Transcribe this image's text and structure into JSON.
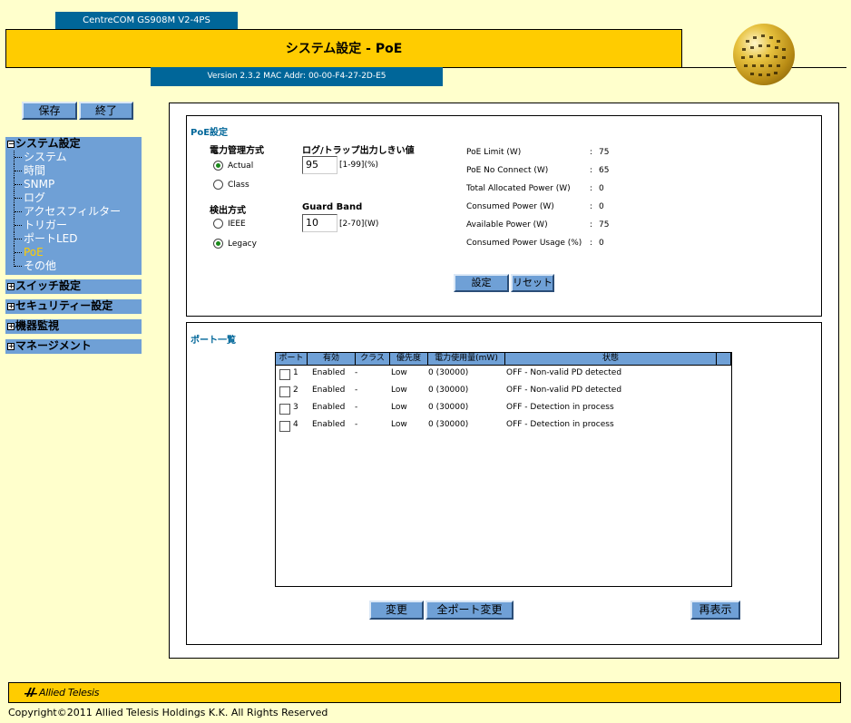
{
  "header": {
    "model": "CentreCOM GS908M V2-4PS",
    "title": "システム設定 - PoE",
    "version": "Version 2.3.2 MAC Addr: 00-00-F4-27-2D-E5"
  },
  "top_buttons": {
    "save": "保存",
    "exit": "終了"
  },
  "sidebar": {
    "system_settings": {
      "label": "システム設定",
      "items": [
        "システム",
        "時間",
        "SNMP",
        "ログ",
        "アクセスフィルター",
        "トリガー",
        "ポートLED",
        "PoE",
        "その他"
      ],
      "active": "PoE"
    },
    "switch_settings": "スイッチ設定",
    "security_settings": "セキュリティー設定",
    "device_monitor": "機器監視",
    "management": "マネージメント"
  },
  "poe": {
    "title": "PoE設定",
    "power_mgmt_label": "電力管理方式",
    "power_mgmt_options": [
      "Actual",
      "Class"
    ],
    "power_mgmt_selected": "Actual",
    "threshold_label": "ログ/トラップ出力しきい値",
    "threshold_value": "95",
    "threshold_range": "[1-99](%)",
    "detect_label": "検出方式",
    "detect_options": [
      "IEEE",
      "Legacy"
    ],
    "detect_selected": "Legacy",
    "guard_band_label": "Guard Band",
    "guard_band_value": "10",
    "guard_band_range": "[2-70](W)",
    "stats": [
      {
        "label": "PoE Limit (W)",
        "value": "75"
      },
      {
        "label": "PoE No Connect (W)",
        "value": "65"
      },
      {
        "label": "Total Allocated Power (W)",
        "value": "0"
      },
      {
        "label": "Consumed Power (W)",
        "value": "0"
      },
      {
        "label": "Available Power (W)",
        "value": "75"
      },
      {
        "label": "Consumed Power Usage (%)",
        "value": "0"
      }
    ],
    "set_button": "設定",
    "reset_button": "リセット"
  },
  "port_list": {
    "title": "ポート一覧",
    "columns": [
      "ポート",
      "有効",
      "クラス",
      "優先度",
      "電力使用量(mW)",
      "状態"
    ],
    "rows": [
      {
        "port": "1",
        "enabled": "Enabled",
        "class": "-",
        "priority": "Low",
        "power": "0 (30000)",
        "status": "OFF - Non-valid PD detected"
      },
      {
        "port": "2",
        "enabled": "Enabled",
        "class": "-",
        "priority": "Low",
        "power": "0 (30000)",
        "status": "OFF - Non-valid PD detected"
      },
      {
        "port": "3",
        "enabled": "Enabled",
        "class": "-",
        "priority": "Low",
        "power": "0 (30000)",
        "status": "OFF - Detection in process"
      },
      {
        "port": "4",
        "enabled": "Enabled",
        "class": "-",
        "priority": "Low",
        "power": "0 (30000)",
        "status": "OFF - Detection in process"
      }
    ],
    "change_button": "変更",
    "change_all_button": "全ポート変更",
    "refresh_button": "再表示"
  },
  "footer": {
    "logo": "Allied Telesis",
    "copyright": "Copyright©2011 Allied Telesis Holdings K.K. All Rights Reserved"
  },
  "colors": {
    "background": "#ffffcc",
    "accent_yellow": "#ffcc00",
    "header_blue": "#006699",
    "nav_blue": "#6fa0d6"
  }
}
